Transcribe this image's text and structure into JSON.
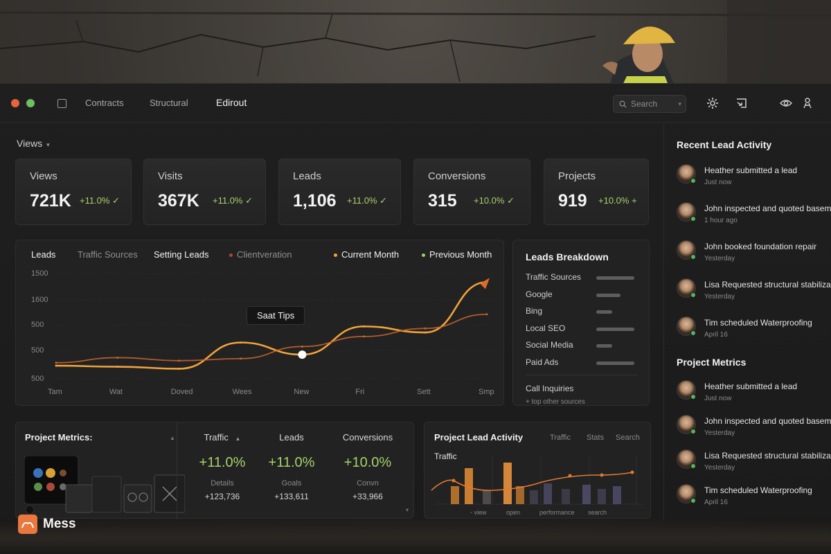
{
  "nav": {
    "tabs": [
      "Contracts",
      "Structural",
      "Edirout"
    ],
    "search_placeholder": "Search"
  },
  "views_label": "Views",
  "stat_cards": [
    {
      "title": "Views",
      "value": "721K",
      "change": "+11.0%",
      "mark": "✓"
    },
    {
      "title": "Visits",
      "value": "367K",
      "change": "+11.0%",
      "mark": "✓"
    },
    {
      "title": "Leads",
      "value": "1,106",
      "change": "+11.0%",
      "mark": "✓"
    },
    {
      "title": "Conversions",
      "value": "315",
      "change": "+10.0%",
      "mark": "✓"
    },
    {
      "title": "Projects",
      "value": "919",
      "change": "+10.0%",
      "mark": "+"
    }
  ],
  "chart": {
    "tabs": [
      "Leads",
      "Traffic Sources",
      "Setting Leads",
      "Clientveration"
    ],
    "legend": [
      {
        "name": "Current Month",
        "color": "#f0a33a"
      },
      {
        "name": "Previous Month",
        "color": "#9ccc64"
      }
    ],
    "tooltip": "Saat Tips"
  },
  "chart_data": {
    "type": "line",
    "x": [
      "Tam",
      "Wat",
      "Doved",
      "Wees",
      "New",
      "Fri",
      "Sett",
      "Smp"
    ],
    "y_ticks": [
      "1500",
      "1600",
      "500",
      "500",
      "500"
    ],
    "series": [
      {
        "name": "Current Month",
        "values": [
          530,
          520,
          500,
          760,
          640,
          920,
          860,
          1360
        ]
      },
      {
        "name": "Previous Month",
        "values": [
          560,
          610,
          580,
          600,
          720,
          820,
          900,
          1040
        ]
      }
    ]
  },
  "breakdown": {
    "title": "Leads Breakdown",
    "rows": [
      {
        "label": "Traffic Sources",
        "level": 0.95
      },
      {
        "label": "Google",
        "level": 0.6
      },
      {
        "label": "Bing",
        "level": 0.4
      },
      {
        "label": "Local SEO",
        "level": 0.95
      },
      {
        "label": "Social Media",
        "level": 0.4
      },
      {
        "label": "Paid Ads",
        "level": 0.95
      }
    ],
    "footer": "Call Inquiries",
    "footer_sub": "+ top other sources"
  },
  "project_metrics": {
    "title": "Project Metrics:",
    "columns": [
      {
        "head": "Traffic",
        "big": "+11.0%",
        "sub": "Details",
        "num": "+123,736"
      },
      {
        "head": "Leads",
        "big": "+11.0%",
        "sub": "Goals",
        "num": "+133,611"
      },
      {
        "head": "Conversions",
        "big": "+10.0%",
        "sub": "Convn",
        "num": "+33,966"
      }
    ]
  },
  "lead_activity_panel": {
    "title": "Project Lead Activity",
    "tabs": [
      "Traffic",
      "Stats",
      "Search"
    ],
    "subtitle": "Traffic",
    "footer": [
      "- view",
      "open",
      "performance",
      "search"
    ]
  },
  "sidebar": {
    "recent_title": "Recent Lead Activity",
    "recent": [
      {
        "text": "Heather submitted a lead",
        "time": "Just now"
      },
      {
        "text": "John inspected and quoted basement",
        "time": "1 hour ago"
      },
      {
        "text": "John booked foundation repair",
        "time": "Yesterday"
      },
      {
        "text": "Lisa Requested structural stabilization",
        "time": "Yesterday"
      },
      {
        "text": "Tim scheduled Waterproofing",
        "time": "April 16"
      }
    ],
    "metrics_title": "Project Metrics",
    "metrics": [
      {
        "text": "Heather submitted a lead",
        "time": "Just now"
      },
      {
        "text": "John inspected and quoted basement",
        "time": "Yesterday"
      },
      {
        "text": "Lisa Requested structural stabilization",
        "time": "Yesterday"
      },
      {
        "text": "Tim scheduled Waterproofing",
        "time": "April 16"
      }
    ]
  },
  "brand": {
    "name": "Mess",
    "color": "#e9783f"
  }
}
